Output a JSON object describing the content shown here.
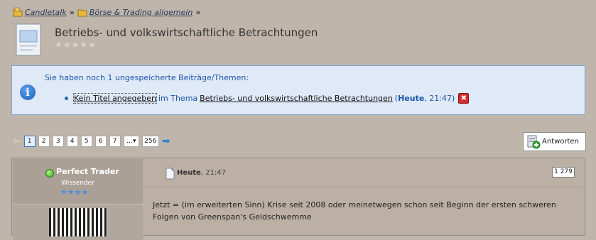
{
  "breadcrumb": {
    "items": [
      {
        "label": "Candletalk",
        "icon": "home-folder-icon"
      },
      {
        "label": "Börse & Trading allgemein",
        "icon": "folder-icon"
      }
    ],
    "separator": "»"
  },
  "thread": {
    "title": "Betriebs- und volkswirtschaftliche Betrachtungen",
    "rating_stars": 5,
    "rating_value": 0
  },
  "notice": {
    "message": "Sie haben noch 1 ungespeicherte Beiträge/Themen:",
    "item": {
      "link_label": "Kein Titel angegeben",
      "in_text": "im Thema",
      "thread_link": "Betriebs- und volkswirtschaftliche Betrachtungen",
      "open_paren": "(",
      "date_bold": "Heute",
      "time": ", 21:47)",
      "delete_glyph": "✖"
    }
  },
  "pagination": {
    "pages": [
      "1",
      "2",
      "3",
      "4",
      "5",
      "6",
      "7"
    ],
    "more": "…▾",
    "last": "256",
    "current": "1",
    "prev_glyph": "⇦",
    "next_glyph": "➡"
  },
  "reply_button": {
    "label": "Antworten"
  },
  "post": {
    "username": "Perfect Trader",
    "rank": "Wissender",
    "rank_stars": 4,
    "date_bold": "Heute",
    "time": ", 21:47",
    "post_number": "1 279",
    "text": "Jetzt = (im erweiterten Sinn) Krise seit 2008 oder meinetwegen schon seit Beginn der ersten schweren Folgen von Greenspan's Geldschwemme"
  },
  "colors": {
    "background": "#bfb5aa",
    "notice_bg": "#dfe9f7",
    "notice_border": "#7ea6d6",
    "link_blue": "#1a56a8",
    "online_green": "#34a81a",
    "delete_red": "#d32c2c"
  }
}
